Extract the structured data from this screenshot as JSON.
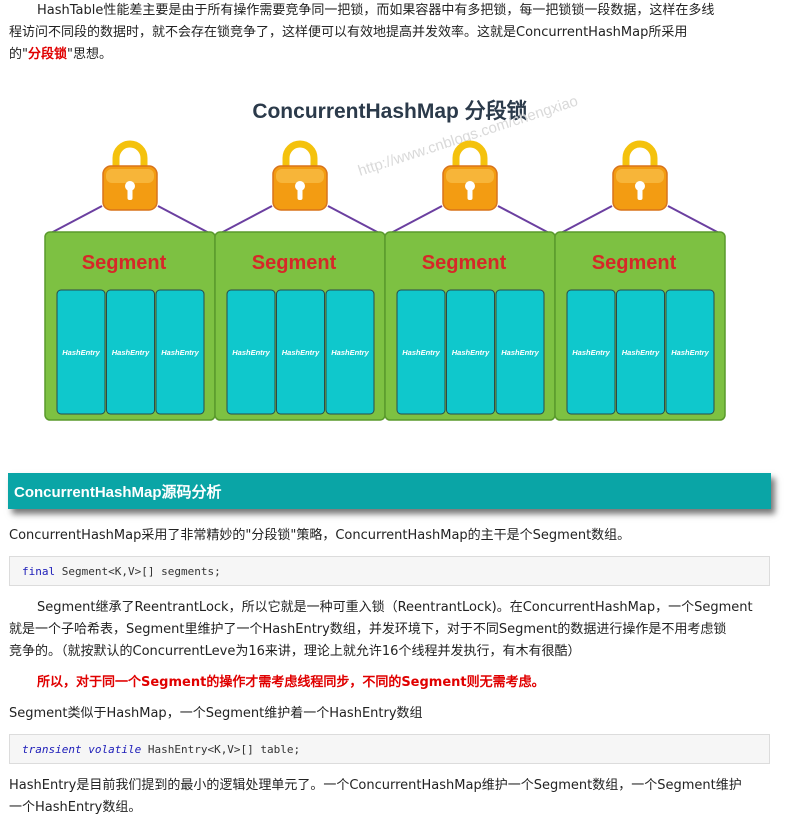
{
  "intro": {
    "line1": "HashTable性能差主要是由于所有操作需要竞争同一把锁，而如果容器中有多把锁，每一把锁锁一段数据，这样在多线",
    "line2": "程访问不同段的数据时，就不会存在锁竞争了，这样便可以有效地提高并发效率。这就是ConcurrentHashMap所采用",
    "line3_prefix": "的\"",
    "line3_highlight": "分段锁",
    "line3_suffix": "\"思想。"
  },
  "figure": {
    "title": "ConcurrentHashMap 分段锁",
    "watermark": "http://www.cnblogs.com/chengxiao",
    "segment_label": "Segment",
    "entry_label": "HashEntry",
    "segment_count": 4,
    "entries_per_segment": 3,
    "colors": {
      "segment_fill": "#7dc142",
      "entry_fill": "#0fc8cc",
      "lock_body": "#f39c12",
      "lock_shackle": "#f4c20d",
      "label_red": "#d62828",
      "line": "#6b3fa0"
    }
  },
  "section_heading": "ConcurrentHashMap源码分析",
  "para1": "ConcurrentHashMap采用了非常精妙的\"分段锁\"策略，ConcurrentHashMap的主干是个Segment数组。",
  "code1": {
    "kw": "final",
    "rest": " Segment<K,V>[] segments;"
  },
  "para2": {
    "line1": "Segment继承了ReentrantLock，所以它就是一种可重入锁（ReentrantLock)。在ConcurrentHashMap，一个Segment",
    "line2": "就是一个子哈希表，Segment里维护了一个HashEntry数组，并发环境下，对于不同Segment的数据进行操作是不用考虑锁",
    "line3": "竞争的。（就按默认的ConcurrentLeve为16来讲，理论上就允许16个线程并发执行，有木有很酷）"
  },
  "emphasis": "所以，对于同一个Segment的操作才需考虑线程同步，不同的Segment则无需考虑。",
  "para3": "Segment类似于HashMap，一个Segment维护着一个HashEntry数组",
  "code2": {
    "kw1": "transient",
    "kw2": "volatile",
    "rest": " HashEntry<K,V>[] table;"
  },
  "para4": {
    "line1": "HashEntry是目前我们提到的最小的逻辑处理单元了。一个ConcurrentHashMap维护一个Segment数组，一个Segment维护",
    "line2": "一个HashEntry数组。"
  }
}
